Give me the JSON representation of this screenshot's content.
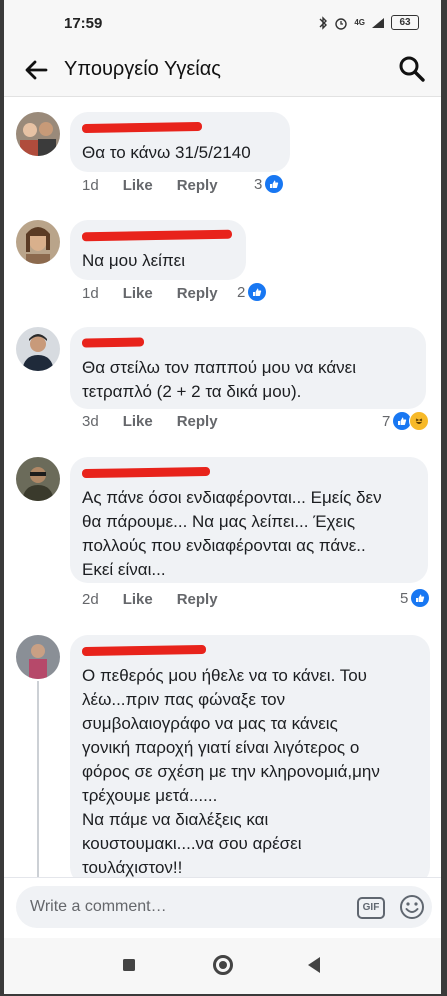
{
  "status_bar": {
    "time": "17:59",
    "network": "4G",
    "battery": "63"
  },
  "header": {
    "title": "Υπουργείο Υγείας"
  },
  "comments": [
    {
      "text": "Θα το κάνω 31/5/2140",
      "time": "1d",
      "like_label": "Like",
      "reply_label": "Reply",
      "reaction_count": "3"
    },
    {
      "text": "Να μου λείπει",
      "time": "1d",
      "like_label": "Like",
      "reply_label": "Reply",
      "reaction_count": "2"
    },
    {
      "text": "Θα στείλω τον παππού μου να κάνει\nτετραπλό (2 + 2 τα δικά μου).",
      "time": "3d",
      "like_label": "Like",
      "reply_label": "Reply",
      "reaction_count": "7"
    },
    {
      "text": "Ας πάνε όσοι ενδιαφέρονται... Εμείς δεν\nθα πάρουμε... Να μας λείπει... Έχεις\nπολλούς που ενδιαφέρονται ας πάνε..\nΕκεί είναι...",
      "time": "2d",
      "like_label": "Like",
      "reply_label": "Reply",
      "reaction_count": "5"
    },
    {
      "text": "Ο πεθερός μου ήθελε να το κάνει. Του\nλέω...πριν πας φώναξε τον\nσυμβολαιογράφο να μας τα κάνεις\nγονική παροχή γιατί είναι λιγότερος ο\nφόρος σε σχέση με την κληρονομιά,μην\nτρέχουμε μετά......\nΝα πάμε να διαλέξεις και\nκουστουμακι....να σου αρέσει\nτουλάχιστον!!"
    }
  ],
  "composer": {
    "placeholder": "Write a comment…",
    "gif_label": "GIF"
  },
  "colors": {
    "accent": "#1877f2",
    "redaction": "#e8231b",
    "bubble": "#f0f2f5"
  }
}
